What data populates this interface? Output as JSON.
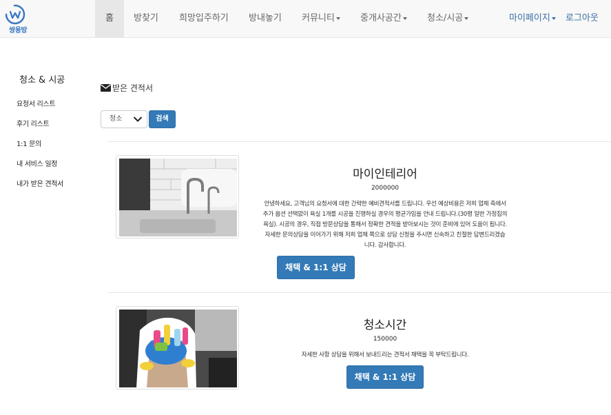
{
  "brand": {
    "name": "쌍용방"
  },
  "nav": {
    "home": "홈",
    "find_room": "방찾기",
    "wish_move": "희망입주하기",
    "list_room": "방내놓기",
    "community": "커뮤니티",
    "agency": "중개사공간",
    "cleaning": "청소/시공",
    "mypage": "마이페이지",
    "logout": "로그아웃"
  },
  "sidebar": {
    "title": "청소 & 시공",
    "items": [
      {
        "label": "요청서 리스트"
      },
      {
        "label": "후기 리스트"
      },
      {
        "label": "1:1 문의"
      },
      {
        "label": "내 서비스 일정"
      },
      {
        "label": "내가 받은 견적서"
      }
    ]
  },
  "main": {
    "title": "받은 견적서",
    "filter": {
      "selected": "청소"
    },
    "search_label": "검색"
  },
  "quotes": [
    {
      "company": "마이인테리어",
      "price": "2000000",
      "desc_lines": [
        "안녕하세요, 고객님의 요청서에 대한 간략한 예비견적서를 드립니다. 우선 예상비용은 저희 업체 측에서",
        "추가 옵션 선택없이 욕실 1개를 시공을 진행하실 경우의 평균가임을 안내 드립니다.(30평 일반 가정집의",
        "욕실). 시공의 경우, 직접 방문상담을 통해서 정확한 견적을 받아보시는 것이 준비에 있어 도움이 됩니다.",
        "자세한 문의상담을 이어가기 위해 저희 업체 쪽으로 상담 신청을 주시면 신속하고 친절한 답변드리겠습",
        "니다. 감사합니다."
      ],
      "button": "채택 & 1:1 상담"
    },
    {
      "company": "청소시간",
      "price": "150000",
      "desc_lines": [
        "자세한 사항 상담을 위해서 보내드리는 견적서 채택을 꼭 부탁드립니다."
      ],
      "button": "채택 & 1:1 상담"
    }
  ],
  "colors": {
    "primary": "#337ab7",
    "navbar_bg": "#f8f8f8",
    "nav_link_right": "#3a6ea5"
  }
}
